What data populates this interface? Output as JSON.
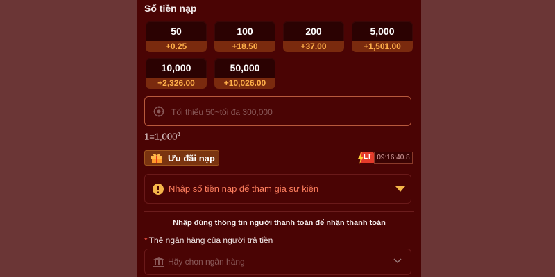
{
  "amount_section": {
    "title": "Số tiền nạp",
    "options": [
      {
        "amount": "50",
        "bonus": "+0.25"
      },
      {
        "amount": "100",
        "bonus": "+18.50"
      },
      {
        "amount": "200",
        "bonus": "+37.00"
      },
      {
        "amount": "5,000",
        "bonus": "+1,501.00"
      },
      {
        "amount": "10,000",
        "bonus": "+2,326.00"
      },
      {
        "amount": "50,000",
        "bonus": "+10,026.00"
      }
    ],
    "input_placeholder": "Tối thiểu 50~tối đa 300,000",
    "input_value": "",
    "rate_text": "1=1,000",
    "rate_unit": "đ"
  },
  "promo": {
    "label": "Ưu đãi nạp",
    "lt_badge": "LT",
    "timer": "09:16:40.8",
    "event_prompt": "Nhập số tiền nạp để tham gia sự kiện"
  },
  "payer": {
    "instruction": "Nhập đúng thông tin người thanh toán để nhận thanh toán",
    "required_mark": "*",
    "bank_label": "Thẻ ngân hàng của người trả tiền",
    "bank_placeholder": "Hãy chọn ngân hàng"
  },
  "colors": {
    "background": "#6b3636",
    "panel": "#4a0404",
    "bonus_text": "#ffb04a",
    "warning": "#f5b64a",
    "accent_red": "#e53b2b"
  },
  "icons": [
    "coin-icon",
    "gift-icon",
    "bolt-icon",
    "warning-icon",
    "triangle-down-icon",
    "bank-icon",
    "chevron-down-icon"
  ]
}
